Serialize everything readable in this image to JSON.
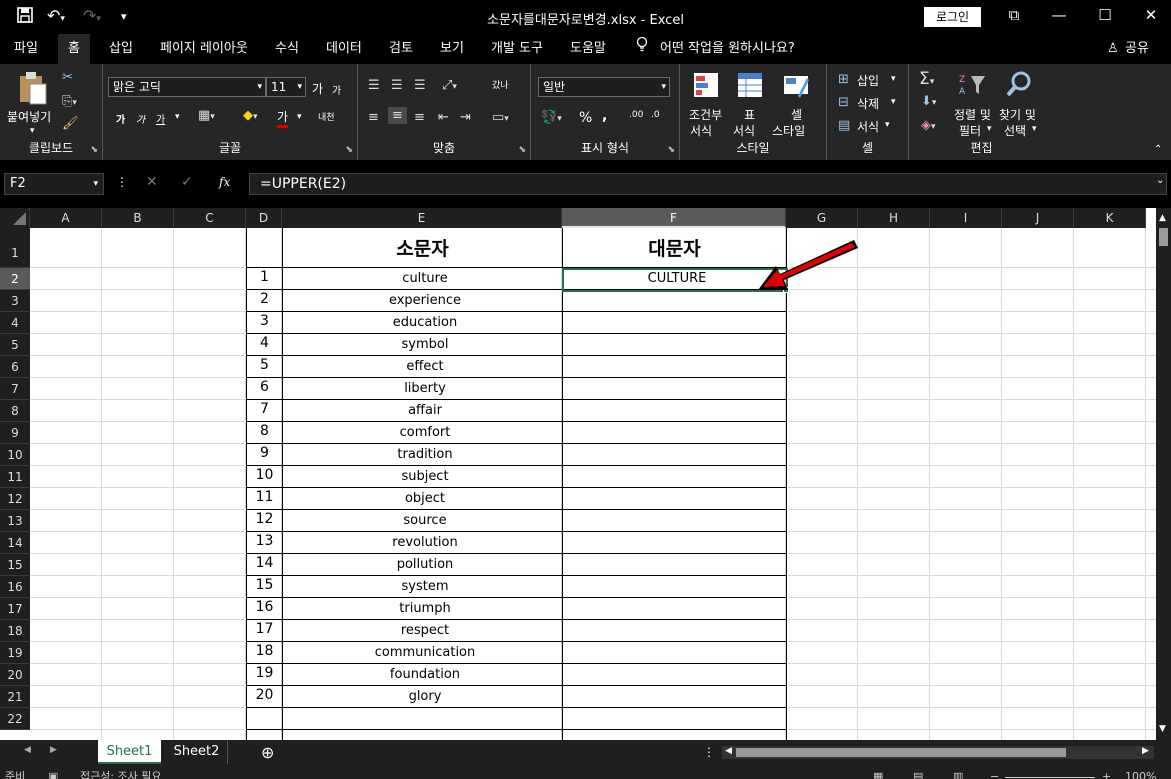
{
  "window": {
    "title": "소문자를대문자로변경.xlsx  -  Excel",
    "login_label": "로그인",
    "minimize": "—",
    "maximize": "☐",
    "close": "✕"
  },
  "quick_access": {
    "save_icon": "save-icon",
    "undo_icon": "undo-icon",
    "redo_icon": "redo-icon",
    "customize_icon": "chevron-down-icon"
  },
  "menu": {
    "tabs": [
      "파일",
      "홈",
      "삽입",
      "페이지 레이아웃",
      "수식",
      "데이터",
      "검토",
      "보기",
      "개발 도구",
      "도움말"
    ],
    "active_tab": "홈",
    "search_text": "어떤 작업을 원하시나요?",
    "share_label": "공유"
  },
  "ribbon": {
    "clipboard": {
      "label": "클립보드",
      "paste": "붙여넣기"
    },
    "font": {
      "label": "글꼴",
      "font_name": "맑은 고딕",
      "font_size": "11",
      "grow": "가",
      "shrink": "가",
      "bold": "가",
      "italic": "가",
      "underline": "가",
      "color_a": "가",
      "phonetic": "내천"
    },
    "alignment": {
      "label": "맞춤",
      "wrap": "갔나"
    },
    "number": {
      "label": "표시 형식",
      "format": "일반",
      "percent": "%",
      "comma": ","
    },
    "styles": {
      "label": "스타일",
      "conditional": "조건부\n서식",
      "conditional_1": "조건부",
      "conditional_2": "서식",
      "table_1": "표",
      "table_2": "서식",
      "cell_1": "셀",
      "cell_2": "스타일"
    },
    "cells": {
      "label": "셀",
      "insert": "삽입",
      "delete": "삭제",
      "format": "서식"
    },
    "editing": {
      "label": "편집",
      "sort_1": "정렬 및",
      "sort_2": "필터",
      "find_1": "찾기 및",
      "find_2": "선택"
    }
  },
  "formula_bar": {
    "name_box": "F2",
    "formula": "=UPPER(E2)",
    "fx": "fx"
  },
  "columns": [
    "A",
    "B",
    "C",
    "D",
    "E",
    "F",
    "G",
    "H",
    "I",
    "J",
    "K"
  ],
  "selected_column": "F",
  "rows": [
    "1",
    "2",
    "3",
    "4",
    "5",
    "6",
    "7",
    "8",
    "9",
    "10",
    "11",
    "12",
    "13",
    "14",
    "15",
    "16",
    "17",
    "18",
    "19",
    "20",
    "21",
    "22"
  ],
  "selected_row": "2",
  "table": {
    "header_lower": "소문자",
    "header_upper": "대문자",
    "numbers": [
      "1",
      "2",
      "3",
      "4",
      "5",
      "6",
      "7",
      "8",
      "9",
      "10",
      "11",
      "12",
      "13",
      "14",
      "15",
      "16",
      "17",
      "18",
      "19",
      "20"
    ],
    "words": [
      "culture",
      "experience",
      "education",
      "symbol",
      "effect",
      "liberty",
      "affair",
      "comfort",
      "tradition",
      "subject",
      "object",
      "source",
      "revolution",
      "pollution",
      "system",
      "triumph",
      "respect",
      "communication",
      "foundation",
      "glory"
    ],
    "upper_results": [
      "CULTURE"
    ]
  },
  "annotation": {
    "arrow_color": "#e00000"
  },
  "sheets": {
    "tabs": [
      "Sheet1",
      "Sheet2"
    ],
    "active": "Sheet1",
    "add_icon": "plus-circle-icon"
  },
  "status": {
    "ready": "준비",
    "accessibility": "접근성: 조사 필요",
    "zoom": "100%"
  },
  "colors": {
    "excel_green": "#217346",
    "ribbon_bg": "#262626"
  }
}
